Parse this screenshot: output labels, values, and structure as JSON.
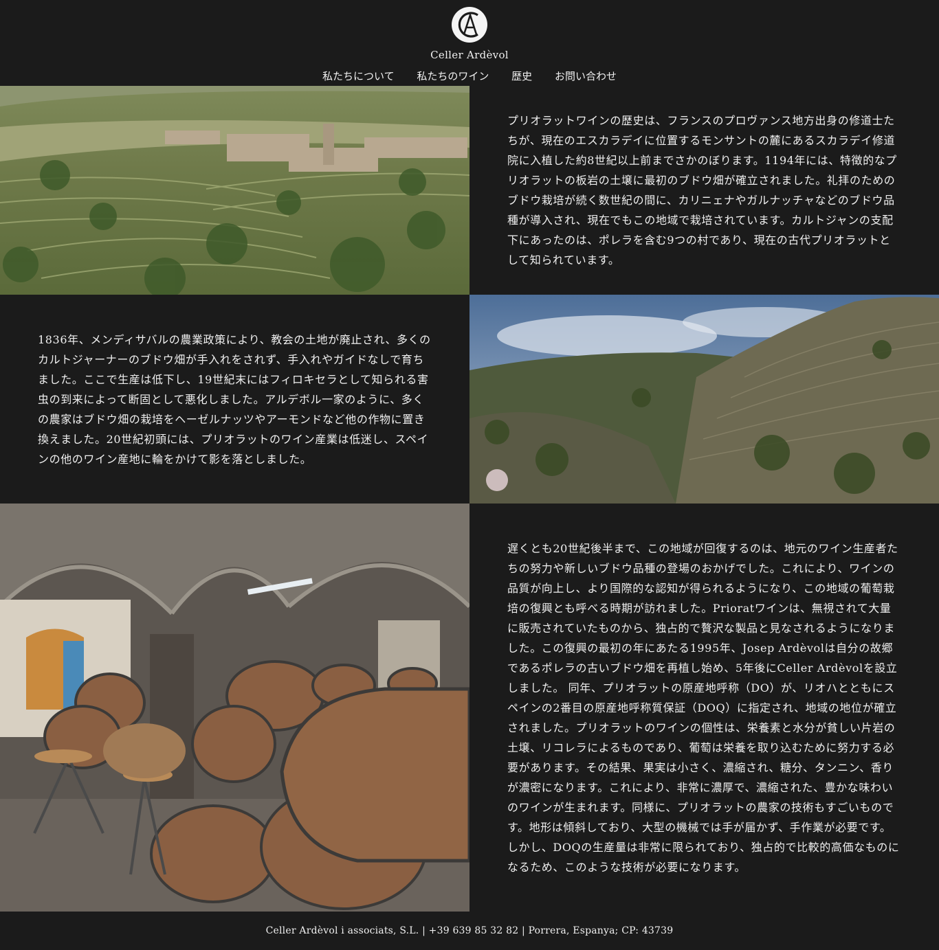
{
  "header": {
    "brand": "Celler Ardèvol",
    "nav": [
      "私たちについて",
      "私たちのワイン",
      "歴史",
      "お問い合わせ"
    ]
  },
  "sections": [
    {
      "text": "プリオラットワインの歴史は、フランスのプロヴァンス地方出身の修道士たちが、現在のエスカラデイに位置するモンサントの麓にあるスカラデイ修道院に入植した約8世紀以上前までさかのぼります。1194年には、特徴的なプリオラットの板岩の土壌に最初のブドウ畑が確立されました。礼拝のためのブドウ栽培が続く数世紀の間に、カリニェナやガルナッチャなどのブドウ品種が導入され、現在でもこの地域で栽培されています。カルトジャンの支配下にあったのは、ポレラを含む9つの村であり、現在の古代プリオラットとして知られています。"
    },
    {
      "text": "1836年、メンディサバルの農業政策により、教会の土地が廃止され、多くのカルトジャーナーのブドウ畑が手入れをされず、手入れやガイドなしで育ちました。ここで生産は低下し、19世紀末にはフィロキセラとして知られる害虫の到来によって断固として悪化しました。アルデボル一家のように、多くの農家はブドウ畑の栽培をヘーゼルナッツやアーモンドなど他の作物に置き換えました。20世紀初頭には、プリオラットのワイン産業は低迷し、スペインの他のワイン産地に輪をかけて影を落としました。"
    },
    {
      "text": "遅くとも20世紀後半まで、この地域が回復するのは、地元のワイン生産者たちの努力や新しいブドウ品種の登場のおかげでした。これにより、ワインの品質が向上し、より国際的な認知が得られるようになり、この地域の葡萄栽培の復興とも呼べる時期が訪れました。Prioratワインは、無視されて大量に販売されていたものから、独占的で贅沢な製品と見なされるようになりました。この復興の最初の年にあたる1995年、Josep Ardèvolは自分の故郷であるポレラの古いブドウ畑を再植し始め、5年後にCeller Ardèvolを設立しました。 同年、プリオラットの原産地呼称（DO）が、リオハとともにスペインの2番目の原産地呼称質保証（DOQ）に指定され、地域の地位が確立されました。プリオラットのワインの個性は、栄養素と水分が貧しい片岩の土壌、リコレラによるものであり、葡萄は栄養を取り込むために努力する必要があります。その結果、果実は小さく、濃縮され、糖分、タンニン、香りが濃密になります。これにより、非常に濃厚で、濃縮された、豊かな味わいのワインが生まれます。同様に、プリオラットの農家の技術もすごいものです。地形は傾斜しており、大型の機械では手が届かず、手作業が必要です。しかし、DOQの生産量は非常に限られており、独占的で比較的高価なものになるため、このような技術が必要になります。"
    }
  ],
  "footer": {
    "text": "Celler Ardèvol i associats, S.L. | +39 639 85 32 82 | Porrera, Espanya; CP: 43739"
  },
  "logo": {
    "letters": "CA"
  }
}
